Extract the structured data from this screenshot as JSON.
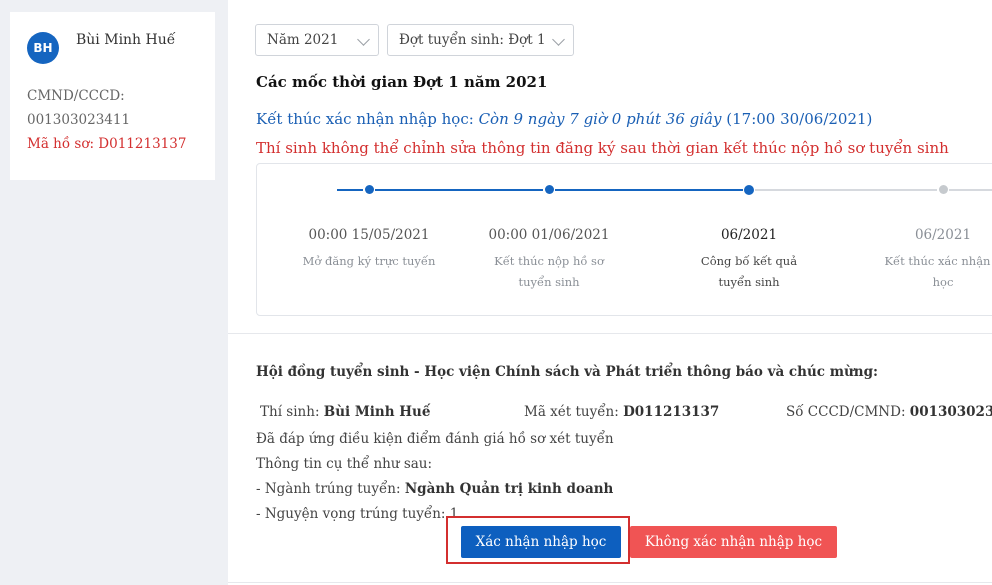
{
  "profile": {
    "avatar_initials": "BH",
    "name": "Bùi Minh Huế",
    "id_label": "CMND/CCCD:",
    "id_value": "001303023411",
    "code_text": "Mã hồ sơ: D011213137"
  },
  "filters": {
    "year_value": "Năm 2021",
    "round_value": "Đợt tuyển sinh: Đợt 1"
  },
  "timeline": {
    "title": "Các mốc thời gian Đợt 1 năm 2021",
    "deadline_prefix": "Kết thúc xác nhận nhập học: ",
    "deadline_countdown": "Còn 9 ngày 7 giờ 0 phút 36 giây",
    "deadline_datetime": " (17:00 30/06/2021)",
    "warning": "Thí sinh không thể chỉnh sửa thông tin đăng ký sau thời gian kết thúc nộp hồ sơ tuyển sinh",
    "steps": [
      {
        "date": "00:00 15/05/2021",
        "label": "Mở đăng ký trực tuyến",
        "status": "done"
      },
      {
        "date": "00:00 01/06/2021",
        "label": "Kết thúc nộp hồ sơ tuyển sinh",
        "status": "done"
      },
      {
        "date": "06/2021",
        "label": "Công bố kết quả tuyển sinh",
        "status": "current"
      },
      {
        "date": "06/2021",
        "label": "Kết thúc xác nhận n học",
        "status": "pending"
      }
    ],
    "colors": {
      "active": "#1565c0",
      "inactive": "#d6d9de"
    }
  },
  "announcement": {
    "title": "Hội đồng tuyển sinh - Học viện Chính sách và Phát triển thông báo và chúc mừng:",
    "candidate_label": "Thí sinh: ",
    "candidate_name": "Bùi Minh Huế",
    "exam_code_label": "Mã xét tuyển: ",
    "exam_code_value": "D011213137",
    "id_label": "Số CCCD/CMND: ",
    "id_value": "001303023",
    "line1": "Đã đáp ứng điều kiện điểm đánh giá hồ sơ xét tuyển",
    "line2": "Thông tin cụ thể như sau:",
    "major_label": "- Ngành trúng tuyển: ",
    "major_value": "Ngành Quản trị kinh doanh",
    "wish_label": "- Nguyện vọng trúng tuyển: ",
    "wish_value": "1"
  },
  "actions": {
    "confirm_label": "Xác nhận nhập học",
    "decline_label": "Không xác nhận nhập học"
  }
}
